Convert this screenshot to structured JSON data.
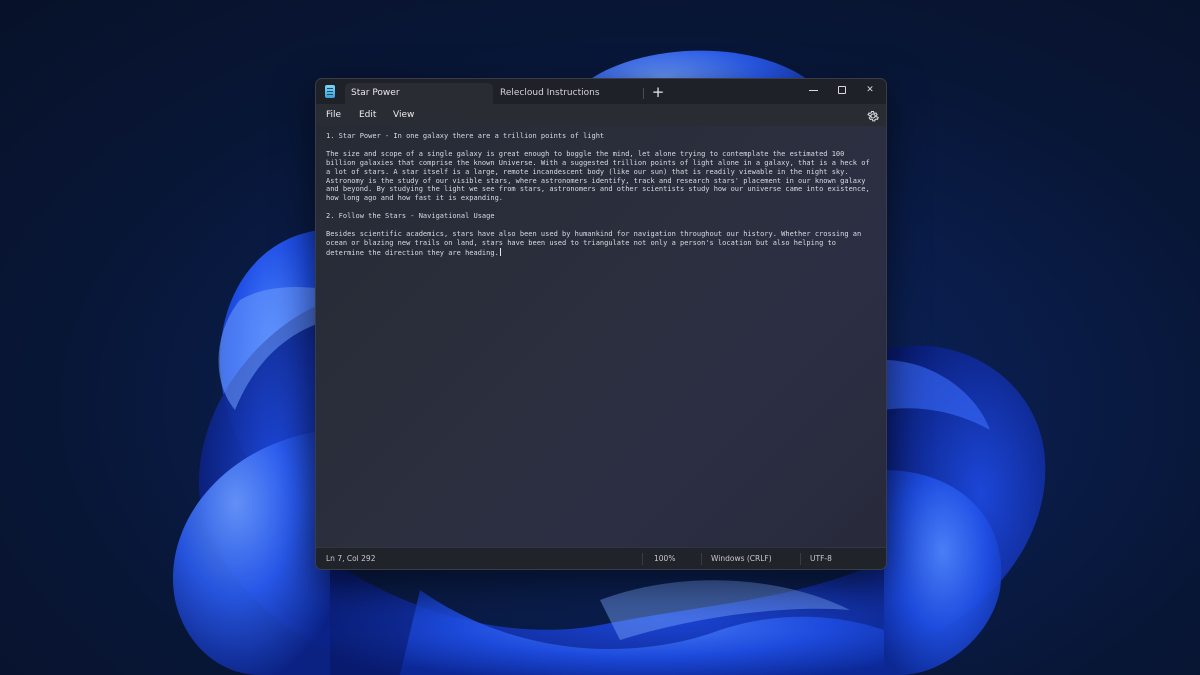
{
  "window": {
    "tabs": [
      {
        "label": "Star Power",
        "active": true
      },
      {
        "label": "Relecloud Instructions",
        "active": false
      }
    ],
    "new_tab_symbol": "+",
    "controls": {
      "close_symbol": "✕"
    }
  },
  "menu": {
    "file": "File",
    "edit": "Edit",
    "view": "View",
    "settings_icon": "gear-icon"
  },
  "document": {
    "paragraphs": [
      "1. Star Power - In one galaxy there are a trillion points of light",
      "The size and scope of a single galaxy is great enough to boggle the mind, let alone trying to contemplate the estimated 100 billion galaxies that comprise the known Universe. With a suggested trillion points of light alone in a galaxy, that is a heck of a lot of stars. A star itself is a large, remote incandescent body (like our sun) that is readily viewable in the night sky. Astronomy is the study of our visible stars, where astronomers identify, track and research stars' placement in our known galaxy and beyond. By studying the light we see from stars, astronomers and other scientists study how our universe came into existence, how long ago and how fast it is expanding.",
      "2. Follow the Stars - Navigational Usage",
      "Besides scientific academics, stars have also been used by humankind for navigation throughout our history. Whether crossing an ocean or blazing new trails on land, stars have been used to triangulate not only a person's location but also helping to determine the direction they are heading."
    ]
  },
  "status": {
    "position": "Ln 7, Col 292",
    "zoom": "100%",
    "line_ending": "Windows (CRLF)",
    "encoding": "UTF-8"
  },
  "colors": {
    "accent_blue": "#1f5fff",
    "window_bg": "#2b2f3d",
    "titlebar_bg": "#1f2128",
    "text": "#d9dbe2"
  }
}
